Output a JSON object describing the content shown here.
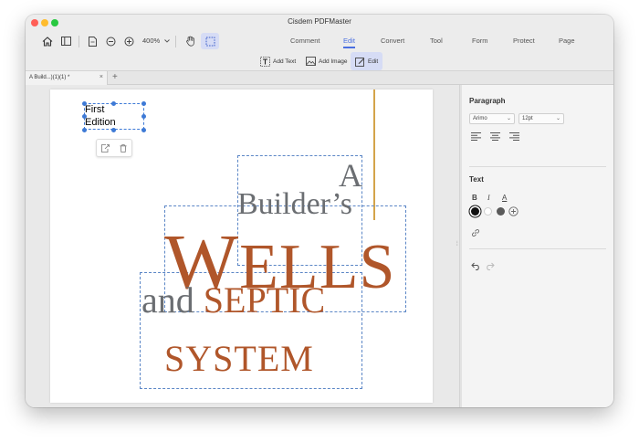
{
  "window": {
    "title": "Cisdem PDFMaster"
  },
  "toolbar": {
    "zoom": "400%",
    "tabs": [
      {
        "label": "Comment"
      },
      {
        "label": "Edit"
      },
      {
        "label": "Convert"
      },
      {
        "label": "Tool"
      },
      {
        "label": "Form"
      },
      {
        "label": "Protect"
      },
      {
        "label": "Page"
      }
    ],
    "active_tab": "Edit"
  },
  "subtoolbar": {
    "add_text": "Add Text",
    "add_image": "Add Image",
    "edit": "Edit"
  },
  "doc_tab": {
    "name": "A Build...)(1)(1) *",
    "close": "×",
    "add": "+"
  },
  "page": {
    "selected_text_line1": "First",
    "selected_text_line2": "Edition",
    "title_a": "A",
    "title_builders": "Builder’s",
    "title_wells_initial": "W",
    "title_wells_rest": "ELLS",
    "title_and": "and",
    "title_septic": "SEPTIC",
    "title_system": "SYSTEM"
  },
  "panel": {
    "paragraph_heading": "Paragraph",
    "font_family": "Arimo",
    "font_size": "12pt",
    "text_heading": "Text",
    "bold": "B",
    "italic": "I",
    "underline": "A"
  },
  "colors": {
    "accent": "#4a6fe0",
    "title_brown": "#b0562a",
    "title_gray": "#6b6e72",
    "swatch_black": "#111111",
    "swatch_white": "#ffffff",
    "swatch_gray": "#5a5a5a"
  }
}
